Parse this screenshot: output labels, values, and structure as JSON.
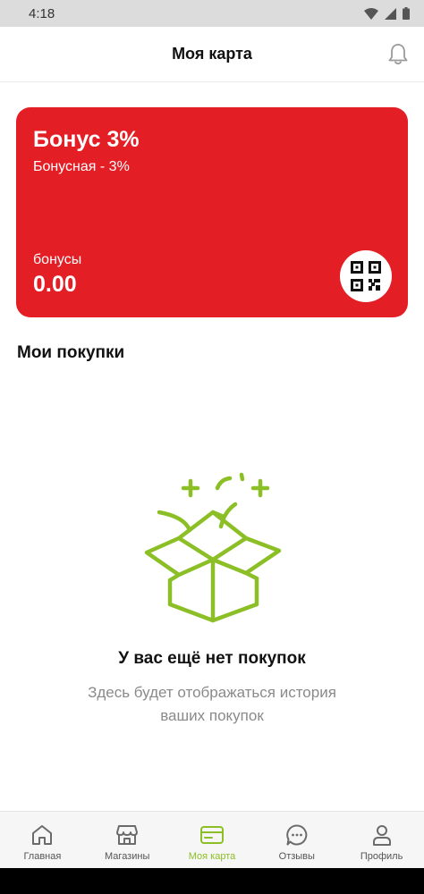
{
  "status_bar": {
    "time": "4:18"
  },
  "header": {
    "title": "Моя карта"
  },
  "card": {
    "title": "Бонус 3%",
    "subtitle": "Бонусная - 3%",
    "bonus_label": "бонусы",
    "bonus_value": "0.00",
    "color": "#e31e24"
  },
  "purchases": {
    "title": "Мои покупки",
    "empty_title": "У вас ещё нет покупок",
    "empty_text": "Здесь будет отображаться история ваших покупок"
  },
  "tabbar": {
    "active_color": "#8cbf26",
    "items": [
      {
        "label": "Главная",
        "icon": "home-icon"
      },
      {
        "label": "Магазины",
        "icon": "store-icon"
      },
      {
        "label": "Моя карта",
        "icon": "card-icon",
        "active": true
      },
      {
        "label": "Отзывы",
        "icon": "chat-icon"
      },
      {
        "label": "Профиль",
        "icon": "profile-icon"
      }
    ]
  }
}
